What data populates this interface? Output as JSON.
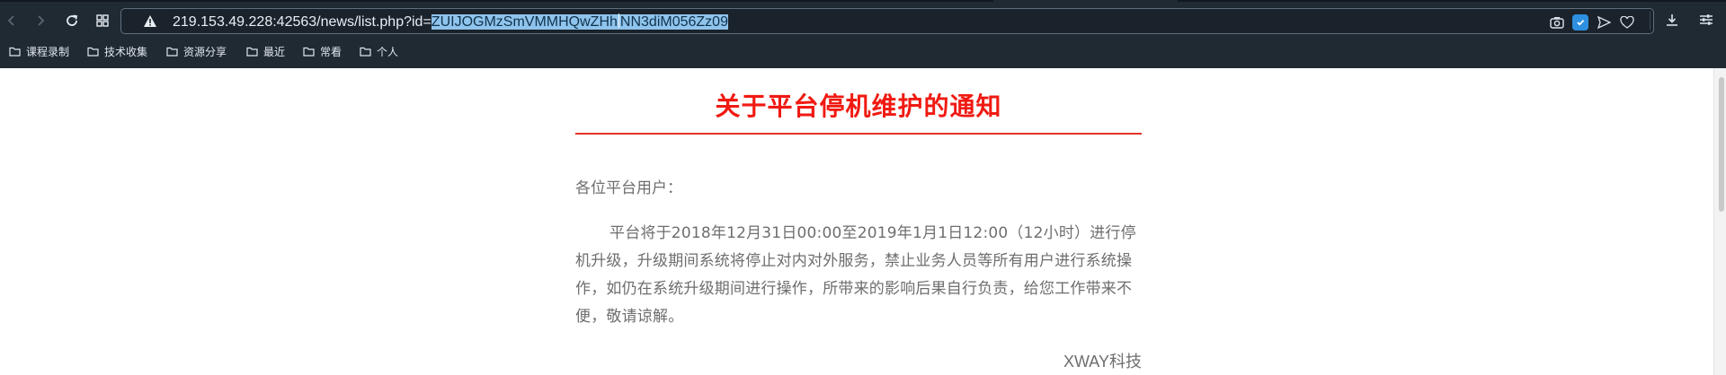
{
  "browser": {
    "url_plain": "219.153.49.228:42563/news/list.php?id=",
    "url_selected_1": "ZUIJOGMzSmVMMHQwZHh",
    "url_selected_2": "NN3diM056Zz09",
    "bookmarks": [
      "课程录制",
      "技术收集",
      "资源分享",
      "最近",
      "常看",
      "个人"
    ]
  },
  "notice": {
    "title": "关于平台停机维护的通知",
    "greeting": "各位平台用户：",
    "body": "平台将于2018年12月31日00:00至2019年1月1日12:00（12小时）进行停机升级，升级期间系统将停止对内对外服务，禁止业务人员等所有用户进行系统操作，如仍在系统升级期间进行操作，所带来的影响后果自行负责，给您工作带来不便，敬请谅解。",
    "signature": "XWAY科技"
  },
  "colors": {
    "title": "#f01a12",
    "rule": "#e2332b",
    "chrome": "#202a33",
    "selection": "#8fc4ec"
  }
}
